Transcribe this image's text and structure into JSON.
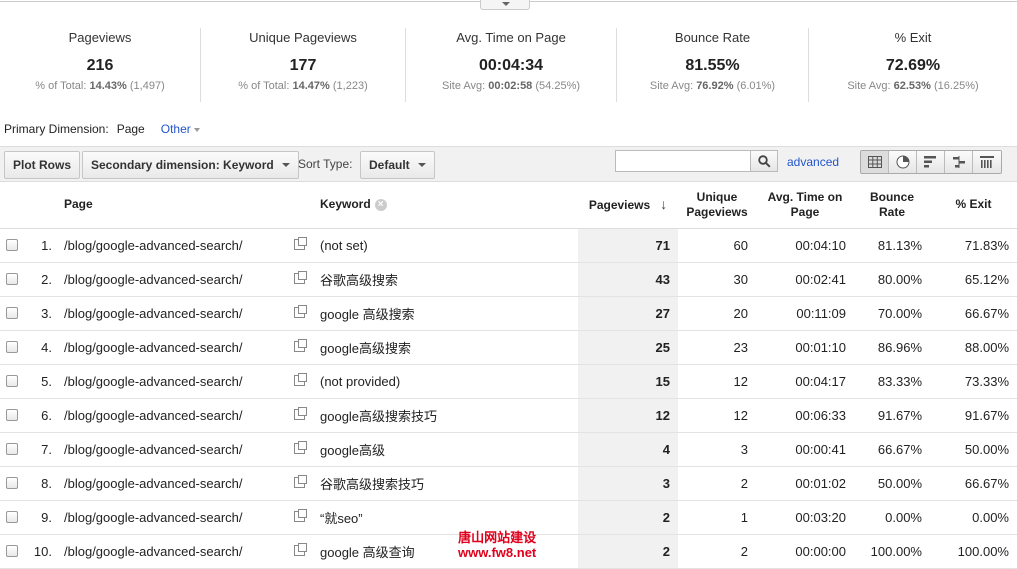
{
  "summary": [
    {
      "label": "Pageviews",
      "value": "216",
      "sub_prefix": "% of Total:",
      "sub_bold": "14.43%",
      "sub_rest": "(1,497)"
    },
    {
      "label": "Unique Pageviews",
      "value": "177",
      "sub_prefix": "% of Total:",
      "sub_bold": "14.47%",
      "sub_rest": "(1,223)"
    },
    {
      "label": "Avg. Time on Page",
      "value": "00:04:34",
      "sub_prefix": "Site Avg:",
      "sub_bold": "00:02:58",
      "sub_rest": "(54.25%)"
    },
    {
      "label": "Bounce Rate",
      "value": "81.55%",
      "sub_prefix": "Site Avg:",
      "sub_bold": "76.92%",
      "sub_rest": "(6.01%)"
    },
    {
      "label": "% Exit",
      "value": "72.69%",
      "sub_prefix": "Site Avg:",
      "sub_bold": "62.53%",
      "sub_rest": "(16.25%)"
    }
  ],
  "dimension": {
    "label": "Primary Dimension:",
    "current": "Page",
    "other": "Other"
  },
  "toolbar": {
    "plot_rows": "Plot Rows",
    "secondary": "Secondary dimension: Keyword",
    "sort_type_label": "Sort Type:",
    "sort_default": "Default",
    "search_value": "",
    "advanced": "advanced"
  },
  "table": {
    "headers": {
      "page": "Page",
      "keyword": "Keyword",
      "pageviews": "Pageviews",
      "unique_pageviews": "Unique Pageviews",
      "avg_time": "Avg. Time on Page",
      "bounce_rate": "Bounce Rate",
      "exit": "% Exit"
    },
    "rows": [
      {
        "idx": "1.",
        "page": "/blog/google-advanced-search/",
        "keyword": "(not set)",
        "pageviews": "71",
        "unique": "60",
        "time": "00:04:10",
        "bounce": "81.13%",
        "exit": "71.83%"
      },
      {
        "idx": "2.",
        "page": "/blog/google-advanced-search/",
        "keyword": "谷歌高级搜索",
        "pageviews": "43",
        "unique": "30",
        "time": "00:02:41",
        "bounce": "80.00%",
        "exit": "65.12%"
      },
      {
        "idx": "3.",
        "page": "/blog/google-advanced-search/",
        "keyword": "google 高级搜索",
        "pageviews": "27",
        "unique": "20",
        "time": "00:11:09",
        "bounce": "70.00%",
        "exit": "66.67%"
      },
      {
        "idx": "4.",
        "page": "/blog/google-advanced-search/",
        "keyword": "google高级搜索",
        "pageviews": "25",
        "unique": "23",
        "time": "00:01:10",
        "bounce": "86.96%",
        "exit": "88.00%"
      },
      {
        "idx": "5.",
        "page": "/blog/google-advanced-search/",
        "keyword": "(not provided)",
        "pageviews": "15",
        "unique": "12",
        "time": "00:04:17",
        "bounce": "83.33%",
        "exit": "73.33%"
      },
      {
        "idx": "6.",
        "page": "/blog/google-advanced-search/",
        "keyword": "google高级搜索技巧",
        "pageviews": "12",
        "unique": "12",
        "time": "00:06:33",
        "bounce": "91.67%",
        "exit": "91.67%"
      },
      {
        "idx": "7.",
        "page": "/blog/google-advanced-search/",
        "keyword": "google高级",
        "pageviews": "4",
        "unique": "3",
        "time": "00:00:41",
        "bounce": "66.67%",
        "exit": "50.00%"
      },
      {
        "idx": "8.",
        "page": "/blog/google-advanced-search/",
        "keyword": "谷歌高级搜索技巧",
        "pageviews": "3",
        "unique": "2",
        "time": "00:01:02",
        "bounce": "50.00%",
        "exit": "66.67%"
      },
      {
        "idx": "9.",
        "page": "/blog/google-advanced-search/",
        "keyword": "“就seo”",
        "pageviews": "2",
        "unique": "1",
        "time": "00:03:20",
        "bounce": "0.00%",
        "exit": "0.00%"
      },
      {
        "idx": "10.",
        "page": "/blog/google-advanced-search/",
        "keyword": "google 高级查询",
        "pageviews": "2",
        "unique": "2",
        "time": "00:00:00",
        "bounce": "100.00%",
        "exit": "100.00%"
      }
    ]
  },
  "watermark": {
    "line1": "唐山网站建设",
    "line2": "www.fw8.net"
  },
  "colors": {
    "link": "#2255cc",
    "watermark": "#e0001b",
    "pageviews_bg": "#f1f1f1"
  }
}
